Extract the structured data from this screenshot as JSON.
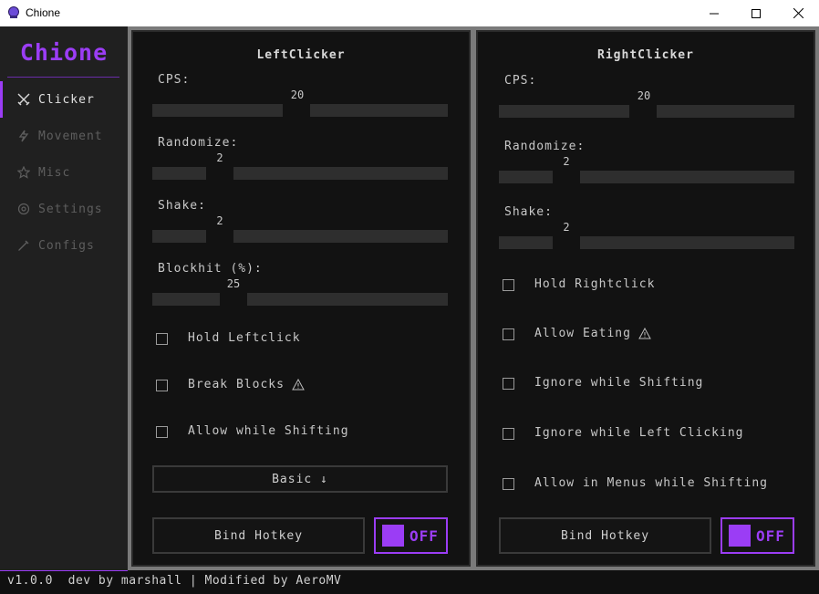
{
  "window": {
    "title": "Chione",
    "minimize_icon": "minimize-icon",
    "maximize_icon": "maximize-icon",
    "close_icon": "close-icon"
  },
  "sidebar": {
    "logo": "Chione",
    "items": [
      {
        "label": "Clicker",
        "icon": "crossed-swords-icon",
        "active": true
      },
      {
        "label": "Movement",
        "icon": "lightning-icon",
        "active": false
      },
      {
        "label": "Misc",
        "icon": "star-icon",
        "active": false
      },
      {
        "label": "Settings",
        "icon": "gear-icon",
        "active": false
      },
      {
        "label": "Configs",
        "icon": "pen-icon",
        "active": false
      }
    ]
  },
  "left": {
    "title": "LeftClicker",
    "cps": {
      "label": "CPS:",
      "value": "20"
    },
    "randomize": {
      "label": "Randomize:",
      "value": "2"
    },
    "shake": {
      "label": "Shake:",
      "value": "2"
    },
    "blockhit": {
      "label": "Blockhit (%):",
      "value": "25"
    },
    "checks": [
      {
        "label": "Hold Leftclick",
        "checked": false,
        "warn": false
      },
      {
        "label": "Break Blocks",
        "checked": false,
        "warn": true
      },
      {
        "label": "Allow while Shifting",
        "checked": false,
        "warn": false
      }
    ],
    "mode_button": "Basic ↓",
    "bind_button": "Bind Hotkey",
    "toggle": "OFF"
  },
  "right": {
    "title": "RightClicker",
    "cps": {
      "label": "CPS:",
      "value": "20"
    },
    "randomize": {
      "label": "Randomize:",
      "value": "2"
    },
    "shake": {
      "label": "Shake:",
      "value": "2"
    },
    "checks": [
      {
        "label": "Hold Rightclick",
        "checked": false,
        "warn": false
      },
      {
        "label": "Allow Eating",
        "checked": false,
        "warn": true
      },
      {
        "label": "Ignore while Shifting",
        "checked": false,
        "warn": false
      },
      {
        "label": "Ignore while Left Clicking",
        "checked": false,
        "warn": false
      },
      {
        "label": "Allow in Menus while Shifting",
        "checked": false,
        "warn": false
      }
    ],
    "bind_button": "Bind Hotkey",
    "toggle": "OFF"
  },
  "footer": {
    "text": "v1.0.0  dev by marshall | Modified by AeroMV"
  },
  "colors": {
    "accent": "#9b3df5",
    "background": "#121212",
    "sidebar": "#202020"
  }
}
